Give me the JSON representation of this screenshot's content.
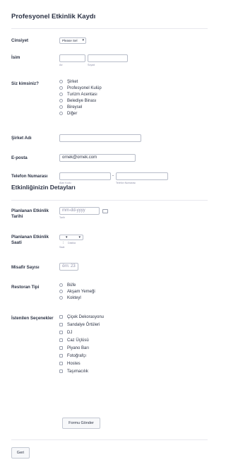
{
  "form": {
    "title": "Profesyonel Etkinlik Kaydı",
    "section2_title": "Etkinliğinizin Detayları"
  },
  "fields": {
    "cinsiyet_label": "Cinsiyet",
    "cinsiyet_value": "Please Sel",
    "isim_label": "İsim",
    "ad_sub": "Ad",
    "soyad_sub": "Soyad",
    "siz_label": "Siz kimsiniz?",
    "siz_options": [
      "Şirket",
      "Profesyonel Kulüp",
      "Turizm Acentası",
      "Belediye Binası",
      "Bireysel",
      "Diğer"
    ],
    "sirket_label": "Şirket Adı",
    "eposta_label": "E-posta",
    "eposta_placeholder": "ornek@ornek.com",
    "telefon_label": "Telefon Numarası",
    "alan_kodu_sub": "Alan Kodu",
    "telefon_sub": "Telefon Numarası",
    "telefon_dash": "-",
    "tarih_label_1": "Planlanan Etkinlik",
    "tarih_label_2": "Tarihi",
    "tarih_placeholder": "mm-dd-yyyy",
    "tarih_sub": "Tarih",
    "saat_label_1": "Planlanan Etkinlik",
    "saat_label_2": "Saati",
    "saat_colon": ":",
    "saat_sub": "Saat",
    "dakika_sub": "Dakika",
    "misafir_label": "Misafir Sayısı",
    "misafir_placeholder": "örn: 23",
    "restoran_label": "Restoran Tipi",
    "restoran_options": [
      "Büfe",
      "Akşam Yemeği",
      "Kokteyl"
    ],
    "secenekler_label": "İstenilen Seçenekler",
    "secenekler_options": [
      "Çiçek Dekorasyonu",
      "Sandalye Örtüleri",
      "DJ",
      "Caz Üçlüsü",
      "Piyano Barı",
      "Fotoğrafçı",
      "Hostes",
      "Taşımacılık"
    ]
  },
  "buttons": {
    "submit_label": "Formu Gönder",
    "back_label": "Geri"
  },
  "icons": {
    "calendar": "calendar-icon",
    "chevron": "chevron-down-icon"
  },
  "colors": {
    "text": "#2c3345",
    "border": "#b8bdc9",
    "sublabel": "#8d8fa8"
  }
}
